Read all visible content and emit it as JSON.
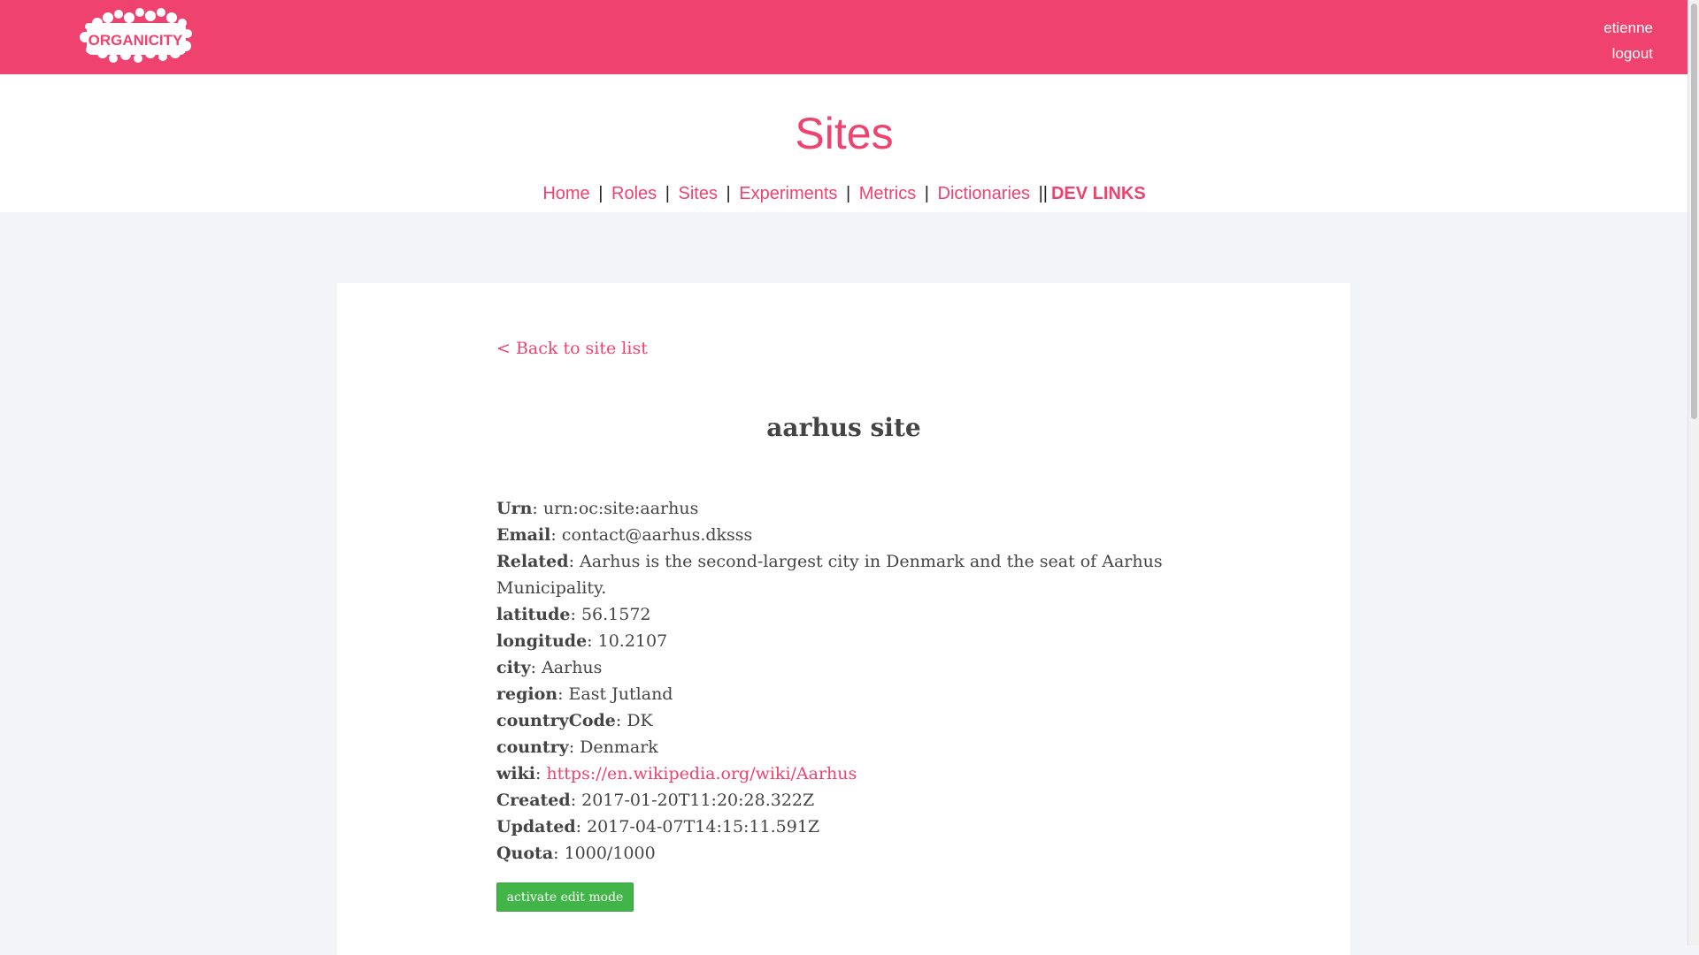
{
  "header": {
    "logo_text": "ORGANICITY",
    "username": "etienne",
    "logout_label": "logout"
  },
  "page_title": "Sites",
  "nav": {
    "home": "Home",
    "roles": "Roles",
    "sites": "Sites",
    "experiments": "Experiments",
    "metrics": "Metrics",
    "dictionaries": "Dictionaries",
    "dev_links": "DEV LINKS",
    "separator": "|",
    "double_separator": "||"
  },
  "site": {
    "back_label": "< Back to site list",
    "title": "aarhus site",
    "fields": [
      {
        "label": "Urn",
        "value": "urn:oc:site:aarhus"
      },
      {
        "label": "Email",
        "value": "contact@aarhus.dksss"
      },
      {
        "label": "Related",
        "value": "Aarhus is the second-largest city in Denmark and the seat of Aarhus Municipality."
      },
      {
        "label": "latitude",
        "value": "56.1572"
      },
      {
        "label": "longitude",
        "value": "10.2107"
      },
      {
        "label": "city",
        "value": "Aarhus"
      },
      {
        "label": "region",
        "value": "East Jutland"
      },
      {
        "label": "countryCode",
        "value": "DK"
      },
      {
        "label": "country",
        "value": "Denmark"
      },
      {
        "label": "wiki",
        "value": "https://en.wikipedia.org/wiki/Aarhus"
      },
      {
        "label": "Created",
        "value": "2017-01-20T11:20:28.322Z"
      },
      {
        "label": "Updated",
        "value": "2017-04-07T14:15:11.591Z"
      },
      {
        "label": "Quota",
        "value": "1000/1000"
      }
    ],
    "edit_button_label": "activate edit mode"
  },
  "colors": {
    "brand": "#f0426e",
    "button": "#42b549",
    "background": "#f3f4f7"
  }
}
